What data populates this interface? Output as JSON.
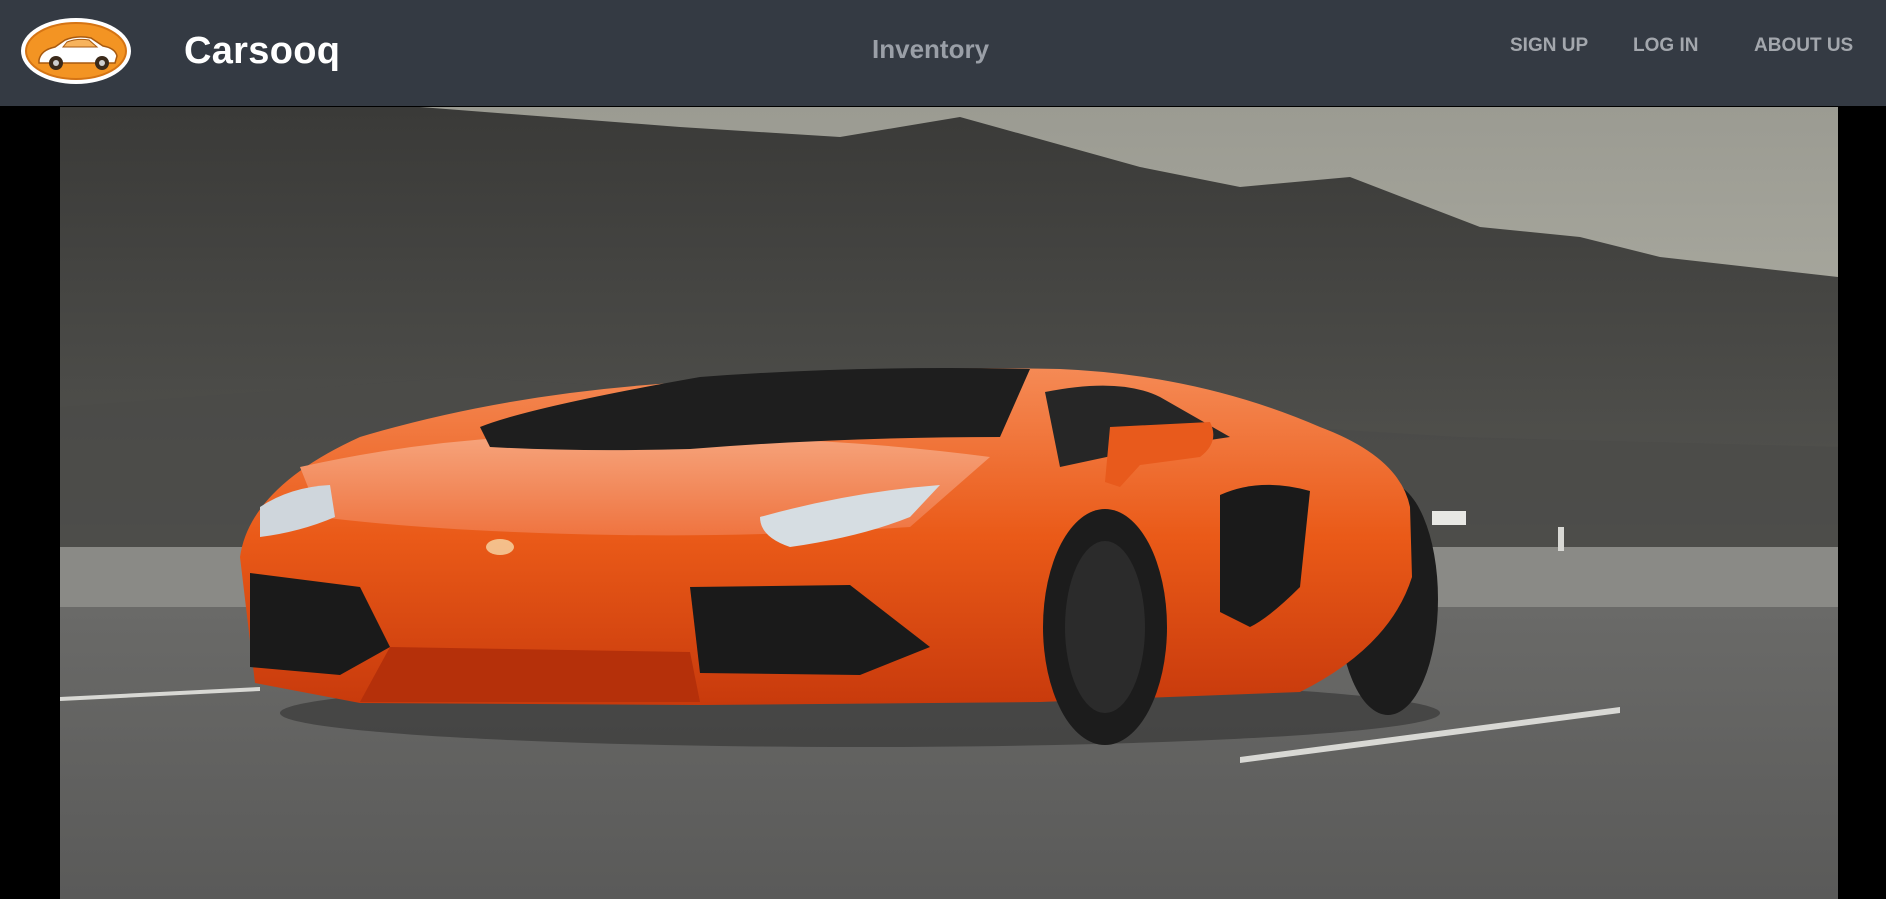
{
  "brand": {
    "name": "Carsooq",
    "logo_icon": "car-logo-icon"
  },
  "nav": {
    "center_link": "Inventory",
    "links": [
      {
        "label": "SIGN UP"
      },
      {
        "label": "LOG IN"
      },
      {
        "label": "ABOUT US"
      }
    ]
  },
  "hero": {
    "image_subject": "orange-sports-car-on-desert-road"
  },
  "colors": {
    "navbar_bg": "#343a43",
    "brand_text": "#ffffff",
    "nav_text": "#a3a7ad",
    "logo_orange": "#f39423",
    "car_orange": "#ea5a18"
  }
}
